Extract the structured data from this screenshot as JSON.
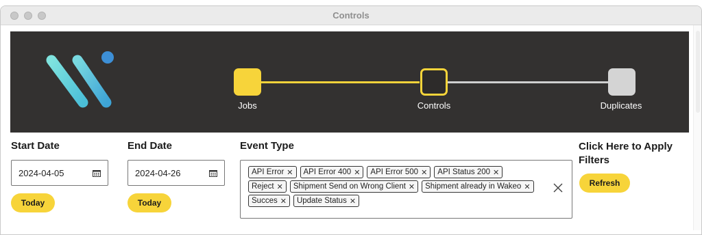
{
  "window": {
    "title": "Controls"
  },
  "stepper": {
    "steps": [
      {
        "label": "Jobs",
        "state": "done"
      },
      {
        "label": "Controls",
        "state": "current"
      },
      {
        "label": "Duplicates",
        "state": "pending"
      }
    ],
    "colors": {
      "active": "#f7d43a",
      "pending": "#d4d4d4",
      "background": "#333130"
    }
  },
  "filters": {
    "start_date": {
      "label": "Start Date",
      "value": "2024-04-05",
      "today_label": "Today"
    },
    "end_date": {
      "label": "End Date",
      "value": "2024-04-26",
      "today_label": "Today"
    },
    "event_type": {
      "label": "Event Type",
      "tags": [
        "API Error",
        "API Error 400",
        "API Error 500",
        "API Status 200",
        "Reject",
        "Shipment Send on Wrong Client",
        "Shipment already in Wakeo",
        "Succes",
        "Update Status"
      ]
    },
    "apply": {
      "label": "Click Here to Apply Filters",
      "refresh_label": "Refresh"
    }
  },
  "icons": {
    "calendar": "calendar-icon",
    "tag_remove": "close-icon",
    "clear_all": "close-icon"
  },
  "accent_color": "#f7d43a"
}
